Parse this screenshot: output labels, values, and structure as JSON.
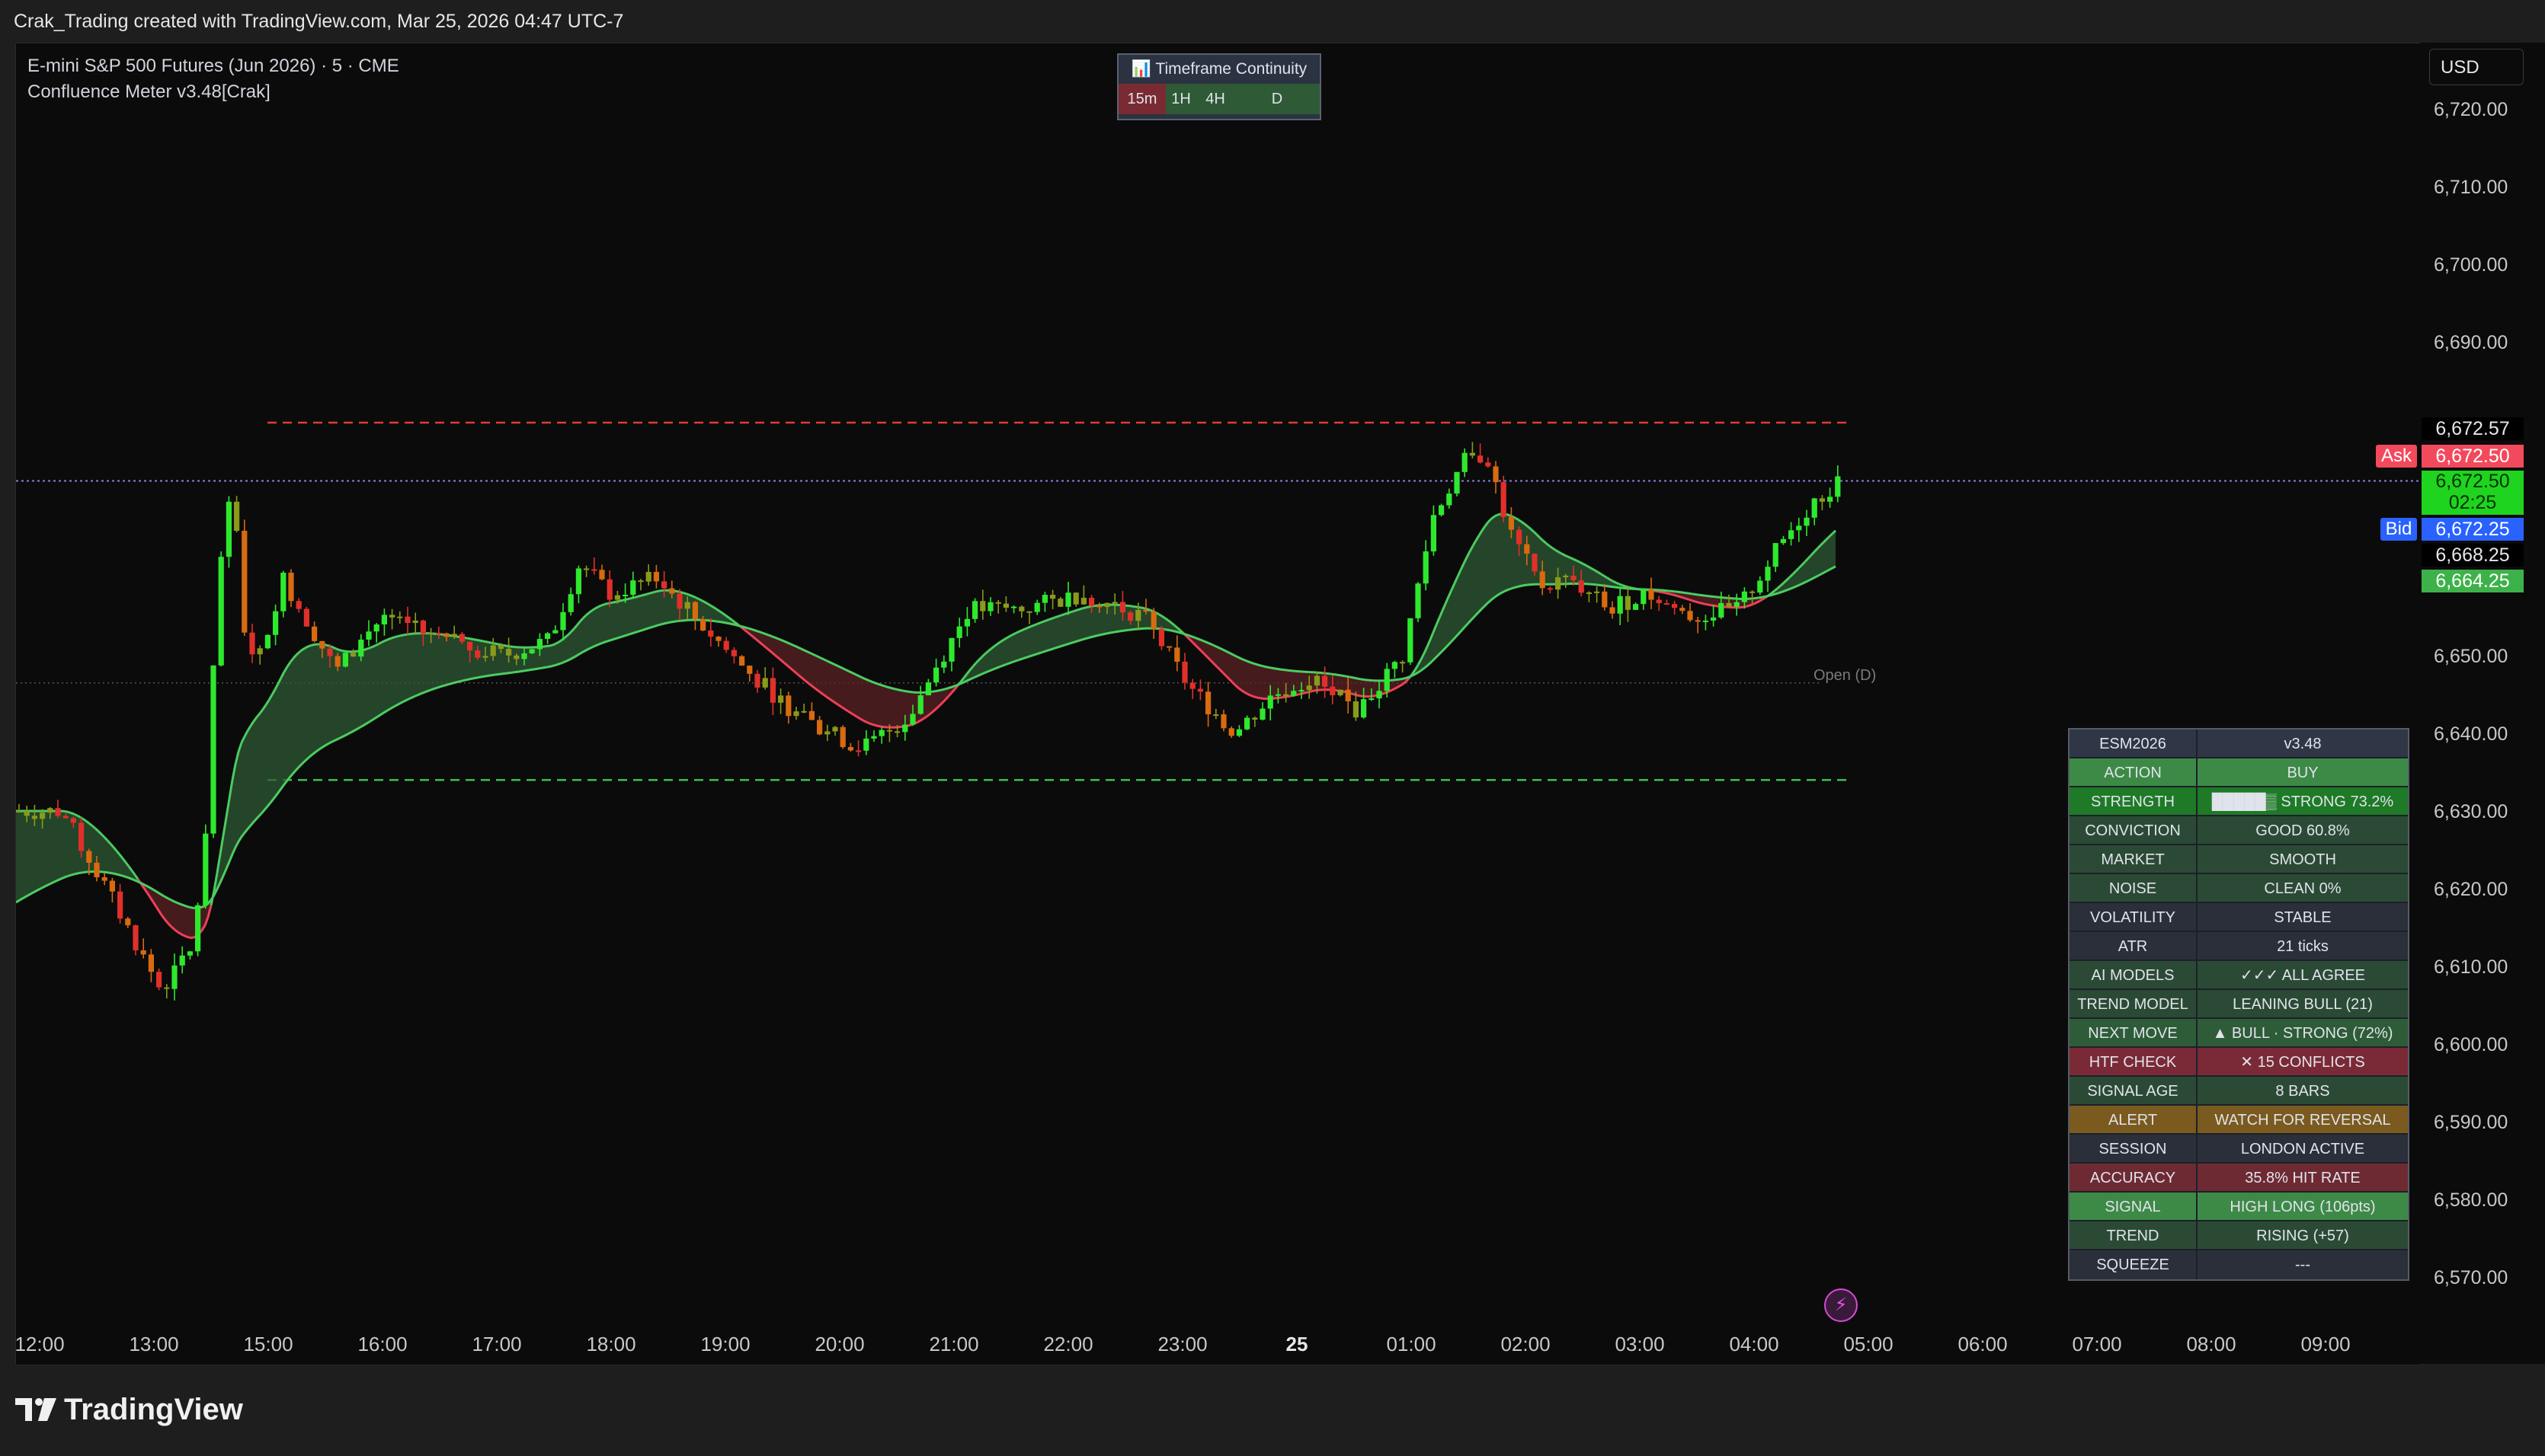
{
  "topbar": {
    "title": "Crak_Trading created with TradingView.com, Mar 25, 2026 04:47 UTC-7"
  },
  "legend": {
    "symbol": "E-mini S&P 500 Futures (Jun 2026) · 5 · CME",
    "indicator": "Confluence Meter v3.48[Crak]"
  },
  "currency": "USD",
  "tf_continuity": {
    "title": "📊 Timeframe Continuity",
    "cells": [
      {
        "label": "15m",
        "color": "#7a2a33"
      },
      {
        "label": "1H",
        "color": "#2f5a36"
      },
      {
        "label": "4H",
        "color": "#2f5a36"
      },
      {
        "label": "D",
        "color": "#2f5a36"
      }
    ]
  },
  "price_axis": {
    "ticks": [
      "6,720.00",
      "6,710.00",
      "6,700.00",
      "6,690.00",
      "6,650.00",
      "6,640.00",
      "6,630.00",
      "6,620.00",
      "6,610.00",
      "6,600.00",
      "6,590.00",
      "6,580.00",
      "6,570.00"
    ],
    "labels": {
      "high": "6,672.57",
      "ask": "6,672.50",
      "last": "6,672.50",
      "countdown": "02:25",
      "bid": "6,672.25",
      "level": "6,668.25",
      "ema": "6,664.25"
    },
    "ask_tag": "Ask",
    "bid_tag": "Bid"
  },
  "time_axis": [
    "12:00",
    "13:00",
    "15:00",
    "16:00",
    "17:00",
    "18:00",
    "19:00",
    "20:00",
    "21:00",
    "22:00",
    "23:00",
    "25",
    "01:00",
    "02:00",
    "03:00",
    "04:00",
    "05:00",
    "06:00",
    "07:00",
    "08:00",
    "09:00"
  ],
  "open_label": "Open (D)",
  "dashboard": {
    "header": {
      "k": "ESM2026",
      "v": "v3.48"
    },
    "rows": [
      {
        "k": "ACTION",
        "v": "BUY",
        "kc": "#3d8a47",
        "vc": "#3d8a47"
      },
      {
        "k": "STRENGTH",
        "v": "█████▒ STRONG 73.2%",
        "kc": "#1e7a26",
        "vc": "#1e7a26"
      },
      {
        "k": "CONVICTION",
        "v": "GOOD 60.8%",
        "kc": "#2b4a35",
        "vc": "#2b4a35"
      },
      {
        "k": "MARKET",
        "v": "SMOOTH",
        "kc": "#2b4a35",
        "vc": "#2b4a35"
      },
      {
        "k": "NOISE",
        "v": "CLEAN 0%",
        "kc": "#2b4a35",
        "vc": "#2b4a35"
      },
      {
        "k": "VOLATILITY",
        "v": "STABLE",
        "kc": "#2a2f3a",
        "vc": "#2a2f3a"
      },
      {
        "k": "ATR",
        "v": "21 ticks",
        "kc": "#2a2f3a",
        "vc": "#2a2f3a"
      },
      {
        "k": "AI MODELS",
        "v": "✓✓✓ ALL AGREE",
        "kc": "#2b4a35",
        "vc": "#2b4a35"
      },
      {
        "k": "TREND MODEL",
        "v": "LEANING BULL (21)",
        "kc": "#2b4a35",
        "vc": "#2b4a35"
      },
      {
        "k": "NEXT MOVE",
        "v": "▲ BULL · STRONG (72%)",
        "kc": "#2e5c38",
        "vc": "#2e5c38"
      },
      {
        "k": "HTF CHECK",
        "v": "✕ 15 CONFLICTS",
        "kc": "#7a2a36",
        "vc": "#7a2a36"
      },
      {
        "k": "SIGNAL AGE",
        "v": "8 BARS",
        "kc": "#2b4a35",
        "vc": "#2b4a35"
      },
      {
        "k": "ALERT",
        "v": "WATCH FOR REVERSAL",
        "kc": "#7a5a1e",
        "vc": "#7a5a1e"
      },
      {
        "k": "SESSION",
        "v": "LONDON ACTIVE",
        "kc": "#2a2f3a",
        "vc": "#2a2f3a"
      },
      {
        "k": "ACCURACY",
        "v": "35.8% HIT RATE",
        "kc": "#6e2a33",
        "vc": "#6e2a33"
      },
      {
        "k": "SIGNAL",
        "v": "HIGH LONG (106pts)",
        "kc": "#3d8a47",
        "vc": "#3d8a47"
      },
      {
        "k": "TREND",
        "v": "RISING (+57)",
        "kc": "#2b4a35",
        "vc": "#2b4a35"
      },
      {
        "k": "SQUEEZE",
        "v": "---",
        "kc": "#2a2f3a",
        "vc": "#2a2f3a"
      }
    ]
  },
  "brand": "TradingView",
  "colors": {
    "bull": "#2ee82e",
    "bear": "#e0302a",
    "olive": "#8a9a1a",
    "orange": "#d86a10",
    "ema_fast_bear": "#f04058",
    "ema_slow": "#4ccc60",
    "ask": "#f2495c",
    "bid": "#2962ff"
  }
}
